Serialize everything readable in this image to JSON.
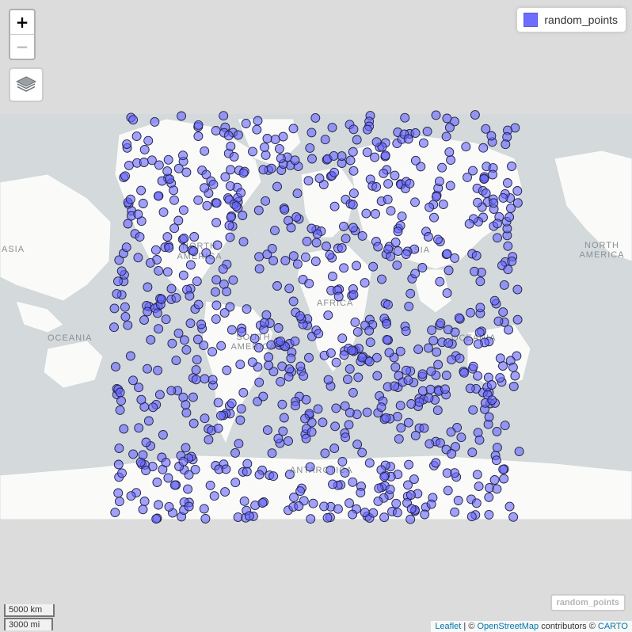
{
  "map": {
    "tile_colors": {
      "water": "#d4dadc",
      "land": "#fafaf8",
      "ocean_outer": "#dcdcdc"
    },
    "labels": {
      "asia_west": "ASIA",
      "north_america_center": "NORTH AMERICA",
      "south_america": "SOUTH AMERICA",
      "africa": "AFRICA",
      "asia_center": "ASIA",
      "oceania_right": "OCEANIA",
      "oceania_left": "OCEANIA",
      "antarctica": "ANTARCTICA",
      "north_america_right": "NORTH AMERICA"
    }
  },
  "controls": {
    "zoom_in": "+",
    "zoom_out": "−",
    "layers_icon": "layers-icon"
  },
  "legend": {
    "label": "random_points",
    "color": "#6666ff"
  },
  "layer_tag": "random_points",
  "scale": {
    "km": "5000 km",
    "mi": "3000 mi"
  },
  "attribution": {
    "leaflet": "Leaflet",
    "sep": " | © ",
    "osm": "OpenStreetMap",
    "contrib": " contributors © ",
    "carto": "CARTO"
  },
  "points": {
    "name": "random_points",
    "color": "#6666ff",
    "stroke": "#222244",
    "count": 900,
    "lon_range": [
      -180,
      180
    ],
    "lat_range": [
      -85,
      85
    ]
  }
}
